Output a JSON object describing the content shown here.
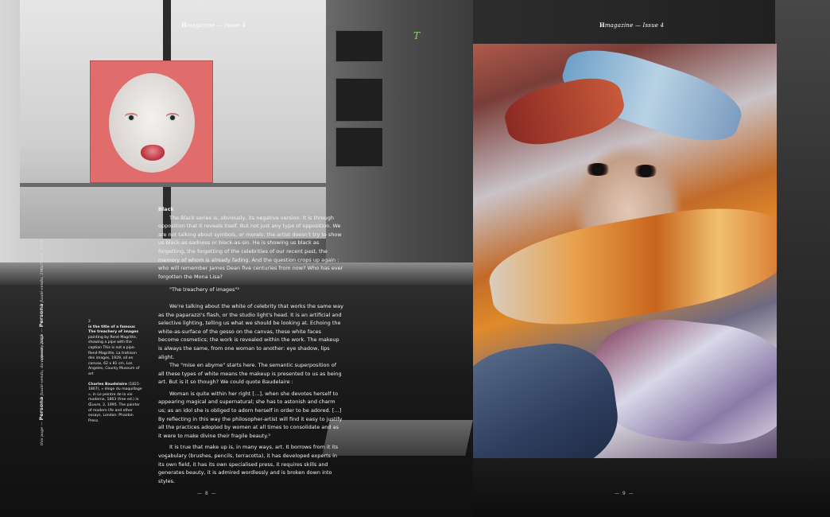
{
  "running_heads": {
    "left": {
      "brand": "H",
      "text": "magazine — Issue 4"
    },
    "right": {
      "brand": "H",
      "text": "magazine — Issue 4"
    }
  },
  "ornament": "T",
  "artworks": {
    "left_icon": "pink-circle-face-artwork",
    "right_icon": "scarf-portrait-painting"
  },
  "article": {
    "heading": "Black",
    "para1": "The Black series is, obviously, its negative version. It is through opposition that it reveals itself. But not just any type of opposition. We are not talking about symbols, or morals: the artist doesn't try to show us black-as-sadness or black-as-sin. He is showing us black as forgetting, the forgetting of the celebrities of our recent past, the memory of whom is already fading. And the question crops up again : who will remember James Dean five centuries from now? Who has ever forgotten the Mona Lisa?",
    "subheading": "\"The treachery of images\"²",
    "para2": "We're talking about the white of celebrity that works the same way as the paparazzi's flash, or the studio light's head. It is an artificial and selective lighting, telling us what we should be looking at. Echoing the white-as-surface of the gesso on the canvas, these white faces become cosmetics; the work is revealed within the work. The makeup is always the same, from one woman to another: eye shadow, lips alight.",
    "para3": "The \"mise en abyme\" starts here. The semantic superposition of all these types of white means the makeup is presented to us as being art. But is it so though? We could quote Baudelaire :",
    "quote": "Woman is quite within her right […], when she devotes herself to appearing magical and supernatural; she has to astonish and charm us; as an idol she is obliged to adorn herself in order to be adored. […] By reflecting in this way the philosopher-artist will find it easy to justify all the practices adopted by women at all times to consolidate and as it were to make divine their fragile beauty.³",
    "para4": "It is true that make up is, in many ways, art. It borrows from it its vocabulary (brushes, pencils, terracotta), it has developed experts in its own field, it has its own specialised press, it requires skills and generates beauty, it is admired wordlessly and is broken down into styles."
  },
  "notes": {
    "n2_num": "2",
    "n2_bold": "is the title of a famous The treachery of images",
    "n2_text": "painting by René Magritte, showing a pipe with the caption This is not a pipe. René Magritte, La trahison des images, 1929, oil on canvas, 62 x 81 cm, Los Angeles, County Museum of art",
    "n3_bold": "Charles Baudelaire",
    "n3_text": "(1821-1867), « éloge du maquillage », in Le peintre de la vie moderne, 1863 (free ed.) in Œuvre, 2, 1995. The painter of modern life and other essays, London: Phaidon Press."
  },
  "vertical_labels": {
    "top_small": "opposite page —",
    "top_bold": "Persona",
    "top_rest": "fiaulé-vendu, 196x75 cm, 2015",
    "bottom_small": "this page —",
    "bottom_bold": "Persona",
    "bottom_rest": "fiaulé-vendu, da-colosse, 2015"
  },
  "small_mark": "3",
  "page_numbers": {
    "left": "— 8 —",
    "right": "— 9 —"
  }
}
